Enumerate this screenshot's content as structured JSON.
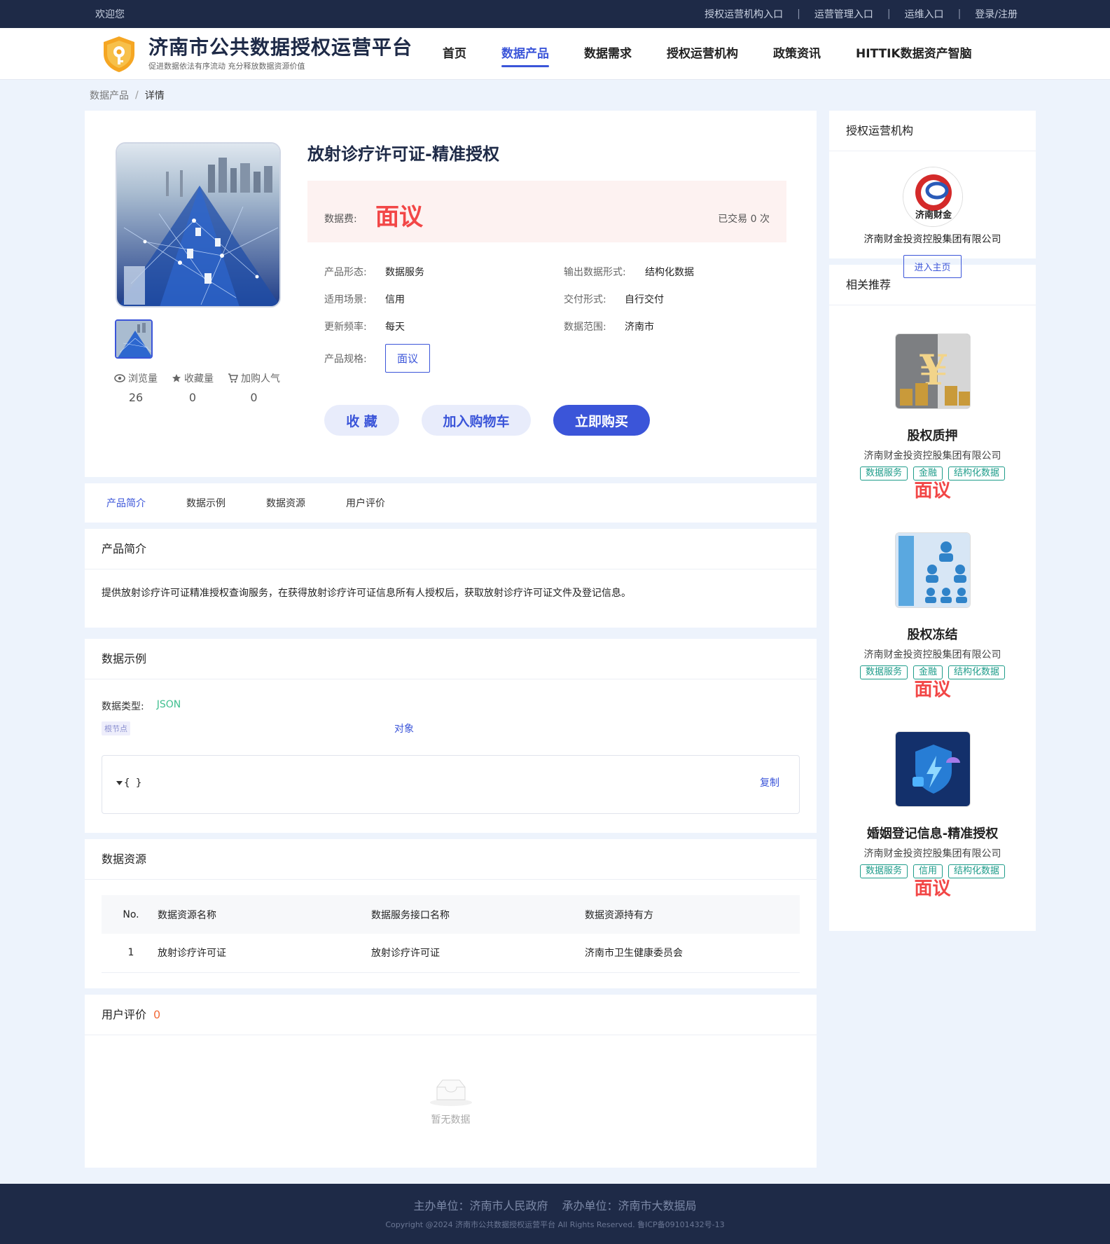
{
  "topbar": {
    "welcome": "欢迎您",
    "links": [
      "授权运营机构入口",
      "运营管理入口",
      "运维入口",
      "登录/注册"
    ],
    "separator": "|"
  },
  "header": {
    "title": "济南市公共数据授权运营平台",
    "slogan": "促进数据依法有序流动 充分释放数据资源价值",
    "nav": [
      "首页",
      "数据产品",
      "数据需求",
      "授权运营机构",
      "政策资讯",
      "HITTIK数据资产智脑"
    ],
    "active_nav": "数据产品"
  },
  "breadcrumb": {
    "parent": "数据产品",
    "separator": "/",
    "current": "详情"
  },
  "product": {
    "title": "放射诊疗许可证-精准授权",
    "price_label": "数据费:",
    "price": "面议",
    "deals": "已交易 0 次",
    "attrs": [
      {
        "k": "产品形态:",
        "v": "数据服务",
        "k2": "输出数据形式:",
        "v2": "结构化数据"
      },
      {
        "k": "适用场景:",
        "v": "信用",
        "k2": "交付形式:",
        "v2": "自行交付"
      },
      {
        "k": "更新频率:",
        "v": "每天",
        "k2": "数据范围:",
        "v2": "济南市"
      }
    ],
    "spec_label": "产品规格:",
    "spec_value": "面议",
    "stats": [
      {
        "label": "浏览量",
        "value": "26",
        "icon": "eye-icon"
      },
      {
        "label": "收藏量",
        "value": "0",
        "icon": "star-icon"
      },
      {
        "label": "加购人气",
        "value": "0",
        "icon": "cart-icon"
      }
    ],
    "buttons": {
      "fav": "收 藏",
      "cart": "加入购物车",
      "buy": "立即购买"
    }
  },
  "tabs": [
    "产品简介",
    "数据示例",
    "数据资源",
    "用户评价"
  ],
  "intro": {
    "heading": "产品简介",
    "text": "提供放射诊疗许可证精准授权查询服务，在获得放射诊疗许可证信息所有人授权后，获取放射诊疗许可证文件及登记信息。"
  },
  "sample": {
    "heading": "数据示例",
    "type_label": "数据类型:",
    "type_value": "JSON",
    "node_tag": "根节点",
    "node_type": "对象",
    "code": "{ }",
    "copy": "复制"
  },
  "resources": {
    "heading": "数据资源",
    "columns": [
      "No.",
      "数据资源名称",
      "数据服务接口名称",
      "数据资源持有方"
    ],
    "rows": [
      [
        "1",
        "放射诊疗许可证",
        "放射诊疗许可证",
        "济南市卫生健康委员会"
      ]
    ]
  },
  "reviews": {
    "heading": "用户评价",
    "count": "0",
    "empty": "暂无数据"
  },
  "org": {
    "heading": "授权运营机构",
    "name": "济南财金投资控股集团有限公司",
    "logo_text": "济南财金",
    "button": "进入主页"
  },
  "recommend": {
    "heading": "相关推荐",
    "items": [
      {
        "title": "股权质押",
        "org": "济南财金投资控股集团有限公司",
        "tags": [
          "数据服务",
          "金融",
          "结构化数据"
        ],
        "price": "面议"
      },
      {
        "title": "股权冻结",
        "org": "济南财金投资控股集团有限公司",
        "tags": [
          "数据服务",
          "金融",
          "结构化数据"
        ],
        "price": "面议"
      },
      {
        "title": "婚姻登记信息-精准授权",
        "org": "济南财金投资控股集团有限公司",
        "tags": [
          "数据服务",
          "信用",
          "结构化数据"
        ],
        "price": "面议"
      }
    ]
  },
  "footer": {
    "host": "主办单位：济南市人民政府",
    "organizer": "承办单位：济南市大数据局",
    "copyright": "Copyright @2024 济南市公共数据授权运营平台 All Rights Reserved. 鲁ICP备09101432号-13"
  },
  "colors": {
    "accent": "#3b55d9",
    "price": "#f24747",
    "topbar": "#1e2a47",
    "tag": "#1e9c8a"
  }
}
